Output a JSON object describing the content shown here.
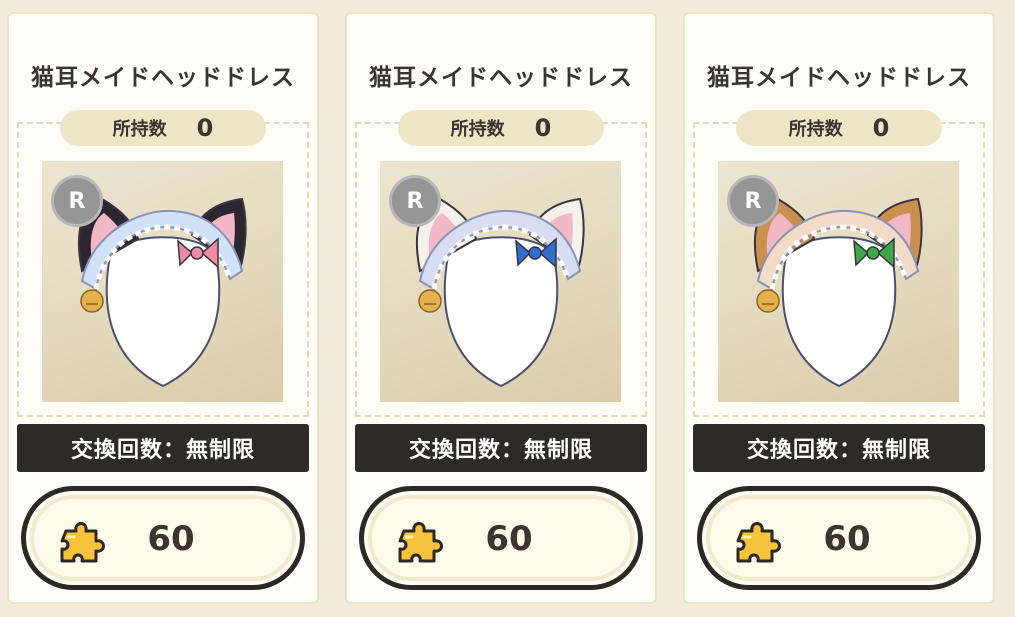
{
  "cards": [
    {
      "title": "猫耳メイドヘッドドレス",
      "owned_label": "所持数",
      "owned_value": "0",
      "rarity": "R",
      "limit_text": "交換回数：無制限",
      "cost": "60",
      "ear_color": "#2b2630",
      "ear_inner": "#f3b8c6",
      "bow_color": "#f08aa6",
      "band_color": "#cfe2f7",
      "cost_icon": "puzzle-piece-icon"
    },
    {
      "title": "猫耳メイドヘッドドレス",
      "owned_label": "所持数",
      "owned_value": "0",
      "rarity": "R",
      "limit_text": "交換回数：無制限",
      "cost": "60",
      "ear_color": "#f5f2ee",
      "ear_inner": "#f3b8c6",
      "bow_color": "#2f6fcf",
      "band_color": "#d7ddf2",
      "cost_icon": "puzzle-piece-icon"
    },
    {
      "title": "猫耳メイドヘッドドレス",
      "owned_label": "所持数",
      "owned_value": "0",
      "rarity": "R",
      "limit_text": "交換回数：無制限",
      "cost": "60",
      "ear_color": "#c8924e",
      "ear_inner": "#f3b8c6",
      "bow_color": "#3da84a",
      "band_color": "#f3dcc7",
      "cost_icon": "puzzle-piece-icon"
    }
  ]
}
